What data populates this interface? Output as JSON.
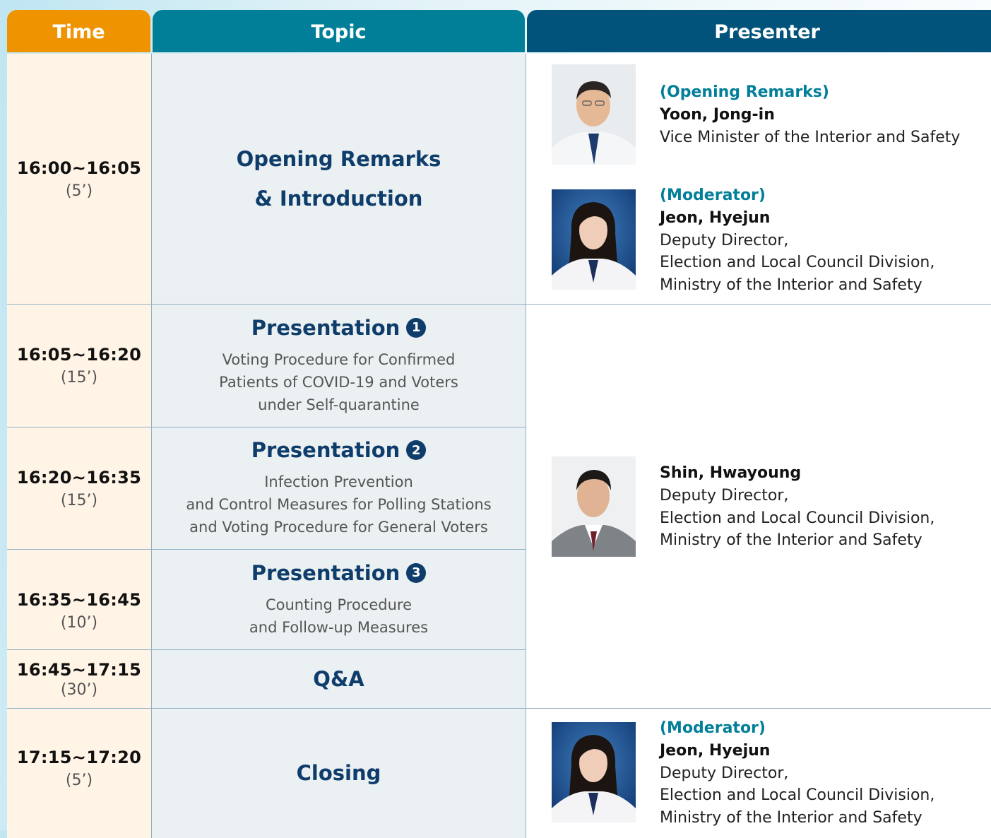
{
  "header": {
    "time": "Time",
    "topic": "Topic",
    "presenter": "Presenter"
  },
  "rows": [
    {
      "time": "16:00~16:05",
      "duration": "(5’)",
      "topic": [
        "Opening Remarks",
        "& Introduction"
      ]
    },
    {
      "time": "16:05~16:20",
      "duration": "(15’)",
      "title": "Presentation",
      "number": "1",
      "desc": [
        "Voting Procedure for Confirmed",
        "Patients of COVID-19 and Voters",
        "under Self-quarantine"
      ]
    },
    {
      "time": "16:20~16:35",
      "duration": "(15’)",
      "title": "Presentation",
      "number": "2",
      "desc": [
        "Infection Prevention",
        "and Control Measures for Polling Stations",
        "and Voting Procedure for General Voters"
      ]
    },
    {
      "time": "16:35~16:45",
      "duration": "(10’)",
      "title": "Presentation",
      "number": "3",
      "desc": [
        "Counting Procedure",
        "and Follow-up Measures"
      ]
    },
    {
      "time": "16:45~17:15",
      "duration": "(30’)",
      "topic": "Q&A"
    },
    {
      "time": "17:15~17:20",
      "duration": "(5’)",
      "topic": "Closing"
    }
  ],
  "presenters": [
    {
      "role": "(Opening Remarks)",
      "name": "Yoon, Jong-in",
      "lines": [
        "Vice Minister of the Interior and Safety"
      ]
    },
    {
      "role": "(Moderator)",
      "name": "Jeon, Hyejun",
      "lines": [
        "Deputy Director,",
        "Election and Local Council Division,",
        "Ministry of the Interior and Safety"
      ]
    },
    {
      "name": "Shin, Hwayoung",
      "lines": [
        "Deputy Director,",
        "Election and Local Council Division,",
        "Ministry of the Interior and Safety"
      ]
    },
    {
      "role": "(Moderator)",
      "name": "Jeon, Hyejun",
      "lines": [
        "Deputy Director,",
        "Election and Local Council Division,",
        "Ministry of the Interior and Safety"
      ]
    }
  ]
}
